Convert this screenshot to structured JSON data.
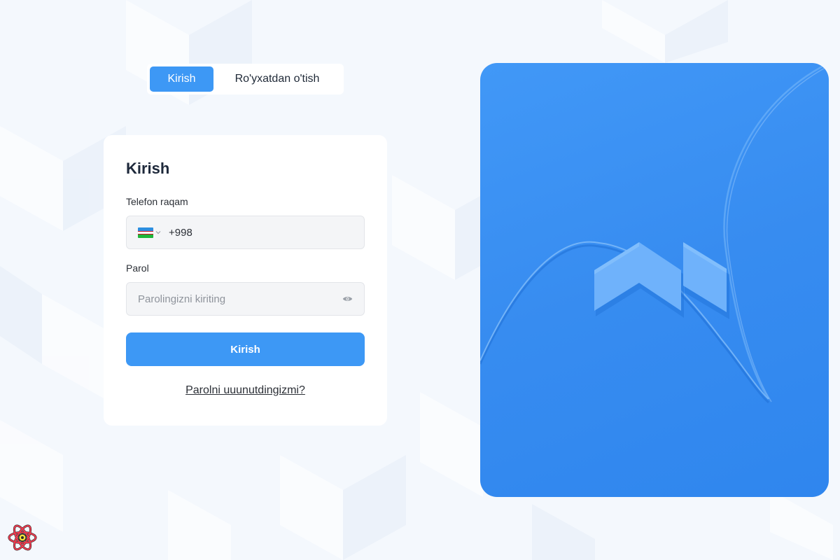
{
  "tabs": {
    "login_label": "Kirish",
    "register_label": "Ro'yxatdan o'tish"
  },
  "form": {
    "title": "Kirish",
    "phone_label": "Telefon raqam",
    "phone_code": "+998",
    "password_label": "Parol",
    "password_placeholder": "Parolingizni kiriting",
    "submit_label": "Kirish",
    "forgot_label": "Parolni uuunutdingizmi?"
  },
  "colors": {
    "accent": "#3d98f5",
    "hero": "#378cf0",
    "background": "#f3f7fc"
  },
  "icons": {
    "flag": "uzbekistan-flag-icon",
    "chevron": "chevron-down-icon",
    "password_toggle": "eye-icon",
    "devtools": "react-logo-icon"
  }
}
